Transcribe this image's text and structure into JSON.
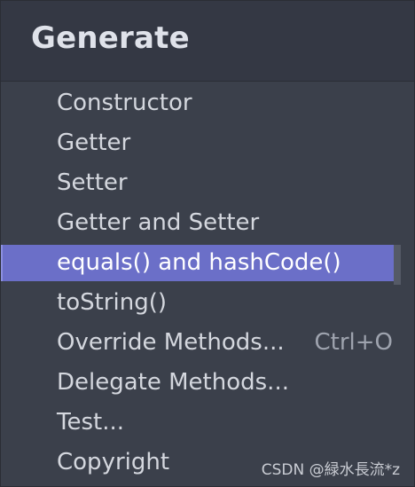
{
  "popup": {
    "title": "Generate",
    "items": [
      {
        "label": "Constructor",
        "shortcut": ""
      },
      {
        "label": "Getter",
        "shortcut": ""
      },
      {
        "label": "Setter",
        "shortcut": ""
      },
      {
        "label": "Getter and Setter",
        "shortcut": ""
      },
      {
        "label": "equals() and hashCode()",
        "shortcut": "",
        "selected": true
      },
      {
        "label": "toString()",
        "shortcut": ""
      },
      {
        "label": "Override Methods...",
        "shortcut": "Ctrl+O"
      },
      {
        "label": "Delegate Methods...",
        "shortcut": ""
      },
      {
        "label": "Test...",
        "shortcut": ""
      },
      {
        "label": "Copyright",
        "shortcut": ""
      }
    ]
  },
  "watermark": "CSDN @緑水長流*z",
  "colors": {
    "background": "#3b404b",
    "header": "#343844",
    "selection": "#6b6fc8",
    "text": "#d4d7de",
    "shortcut": "#9ea3ae"
  }
}
